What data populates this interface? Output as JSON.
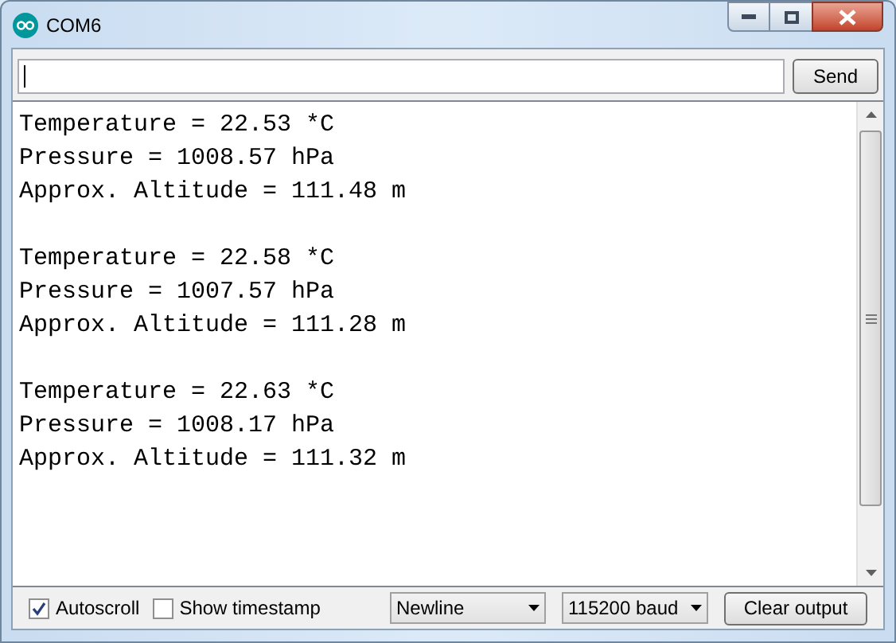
{
  "window": {
    "title": "COM6"
  },
  "send_button": "Send",
  "output_blocks": [
    {
      "lines": [
        "Temperature = 22.53 *C",
        "Pressure = 1008.57 hPa",
        "Approx. Altitude = 111.48 m"
      ]
    },
    {
      "lines": [
        "Temperature = 22.58 *C",
        "Pressure = 1007.57 hPa",
        "Approx. Altitude = 111.28 m"
      ]
    },
    {
      "lines": [
        "Temperature = 22.63 *C",
        "Pressure = 1008.17 hPa",
        "Approx. Altitude = 111.32 m"
      ]
    }
  ],
  "checkboxes": [
    {
      "label": "Autoscroll",
      "checked": true
    },
    {
      "label": "Show timestamp",
      "checked": false
    }
  ],
  "dropdowns": [
    {
      "value": "Newline"
    },
    {
      "value": "115200 baud"
    }
  ],
  "clear_button": "Clear output"
}
